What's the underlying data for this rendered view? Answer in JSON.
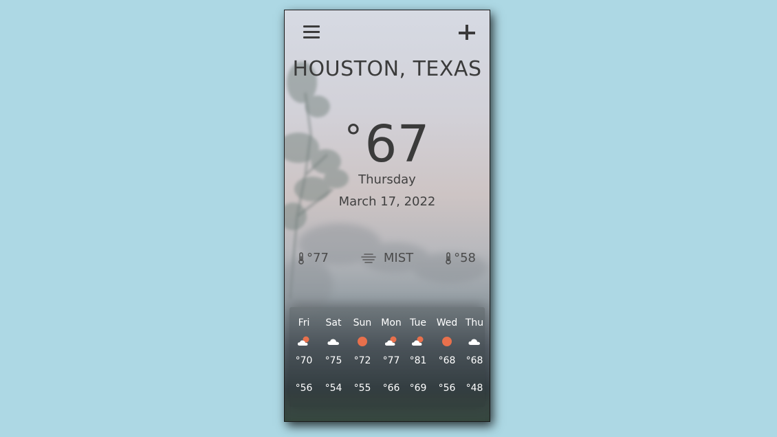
{
  "header": {
    "menu_icon": "hamburger-menu-icon",
    "add_icon": "plus-icon"
  },
  "location": {
    "city": "HOUSTON, TEXAS"
  },
  "current": {
    "temperature": "67",
    "degree_symbol": "°",
    "day": "Thursday",
    "date": "March 17, 2022"
  },
  "stats": {
    "high": "°77",
    "condition": "MIST",
    "low": "°58",
    "high_icon": "thermometer-icon",
    "condition_icon": "mist-icon",
    "low_icon": "thermometer-icon"
  },
  "forecast": [
    {
      "day": "Fri",
      "icon": "partly-cloudy-icon",
      "high": "°70",
      "low": "°56"
    },
    {
      "day": "Sat",
      "icon": "cloud-icon",
      "high": "°75",
      "low": "°54"
    },
    {
      "day": "Sun",
      "icon": "sun-icon",
      "high": "°72",
      "low": "°55"
    },
    {
      "day": "Mon",
      "icon": "partly-cloudy-icon",
      "high": "°77",
      "low": "°66"
    },
    {
      "day": "Tue",
      "icon": "partly-cloudy-icon",
      "high": "°81",
      "low": "°69"
    },
    {
      "day": "Wed",
      "icon": "sun-icon",
      "high": "°68",
      "low": "°56"
    },
    {
      "day": "Thu",
      "icon": "cloud-icon",
      "high": "°68",
      "low": "°48"
    }
  ],
  "colors": {
    "page_background": "#add8e4",
    "text_dark": "#3b3b3b",
    "sun": "#e8704c",
    "forecast_text": "#ffffff"
  }
}
